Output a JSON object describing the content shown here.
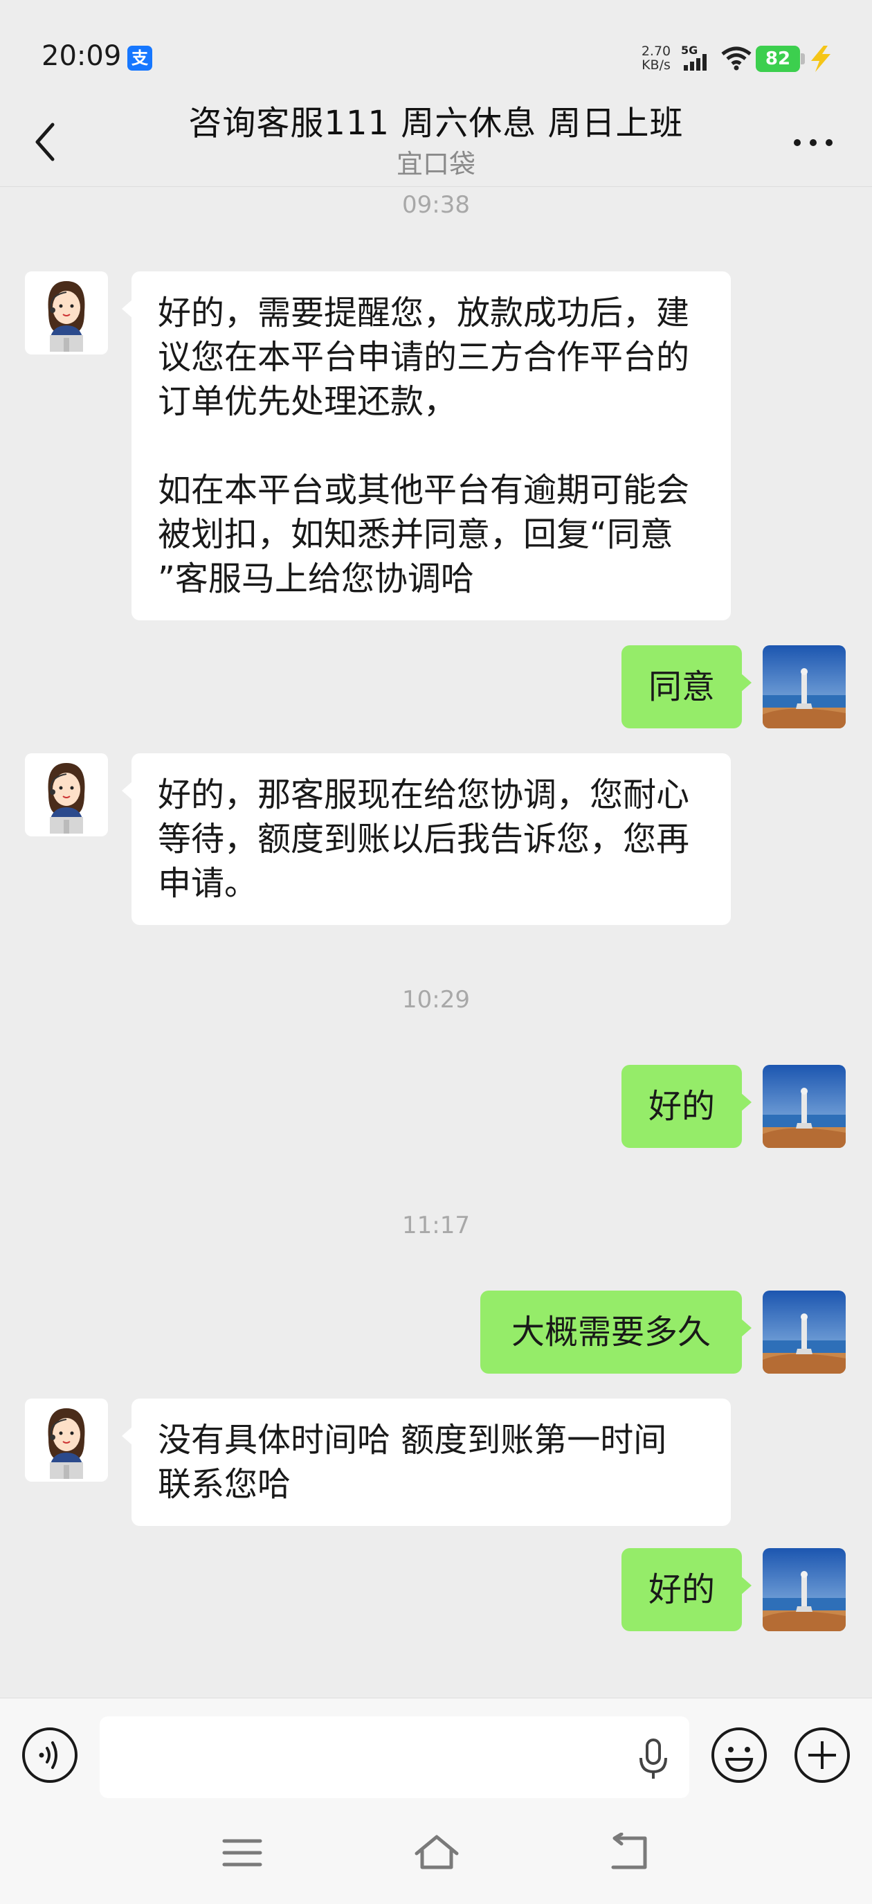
{
  "status_bar": {
    "time": "20:09",
    "alipay_badge": "支",
    "net_speed_value": "2.70",
    "net_speed_unit": "KB/s",
    "network": "5G",
    "battery_level": "82"
  },
  "header": {
    "title": "咨询客服111 周六休息 周日上班",
    "subtitle": "宜口袋"
  },
  "timestamps": [
    "09:38",
    "10:29",
    "11:17"
  ],
  "messages": [
    {
      "from": "agent",
      "text": "好的，需要提醒您，放款成功后，建\n议您在本平台申请的三方合作平台的\n订单优先处理还款，\n\n如在本平台或其他平台有逾期可能会\n被划扣，如知悉并同意，回复“同意\n”客服马上给您协调哈"
    },
    {
      "from": "me",
      "text": "同意"
    },
    {
      "from": "agent",
      "text": "好的，那客服现在给您协调，您耐心\n等待，额度到账以后我告诉您，您再\n申请。"
    },
    {
      "from": "me",
      "text": "好的"
    },
    {
      "from": "me",
      "text": "大概需要多久"
    },
    {
      "from": "agent",
      "text": "没有具体时间哈 额度到账第一时间\n联系您哈"
    },
    {
      "from": "me",
      "text": "好的"
    }
  ],
  "input": {
    "value": "",
    "placeholder": ""
  },
  "colors": {
    "background": "#ededed",
    "sent_bubble": "#95ec69",
    "received_bubble": "#ffffff",
    "timestamp_text": "#a8a8a8"
  }
}
